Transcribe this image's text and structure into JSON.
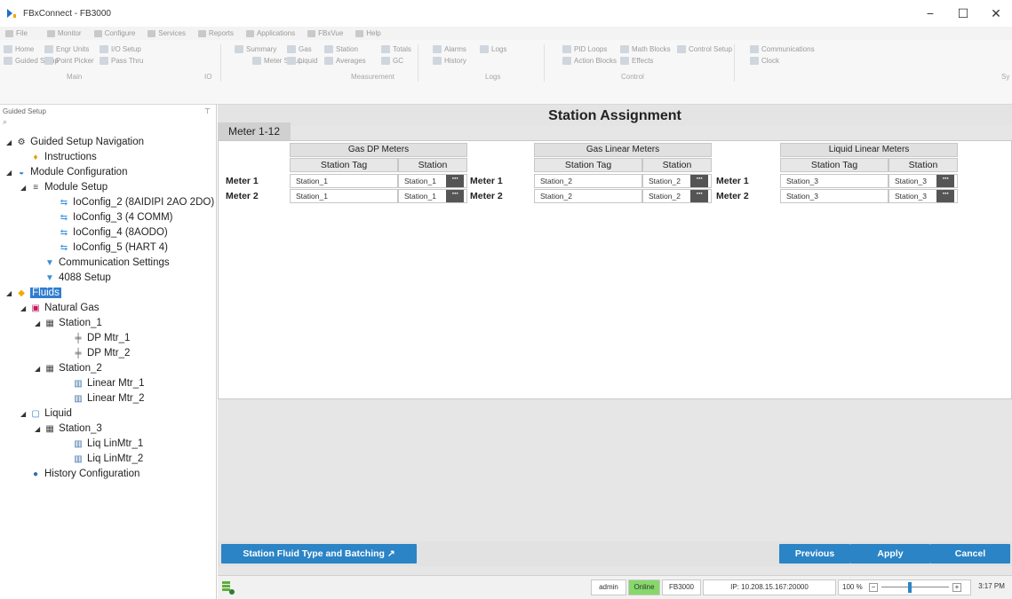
{
  "window": {
    "title": "FBxConnect - FB3000",
    "minimize": "−",
    "maximize": "☐",
    "close": "✕"
  },
  "menu": [
    "File",
    "Monitor",
    "Configure",
    "Services",
    "Reports",
    "Applications",
    "FBxVue",
    "Help"
  ],
  "ribbon": {
    "main": {
      "items": [
        "Home",
        "Engr Units",
        "I/O Setup",
        "Guided Setup",
        "Point Picker",
        "Pass Thru"
      ],
      "group": "Main",
      "group2": "IO"
    },
    "measurement": {
      "items": [
        "Summary",
        "Gas",
        "Station",
        "Totals",
        "Meter Setup",
        "Liquid",
        "Averages",
        "GC"
      ],
      "group": "Measurement"
    },
    "logs": {
      "items": [
        "Alarms",
        "Logs",
        "History"
      ],
      "group": "Logs"
    },
    "control": {
      "items": [
        "PID Loops",
        "Math Blocks",
        "Control Setup",
        "Action Blocks",
        "Effects"
      ],
      "group": "Control"
    },
    "comm": {
      "items": [
        "Communications",
        "Clock"
      ],
      "group": "Sy"
    }
  },
  "leftpanel": {
    "title": "Guided Setup",
    "pin": "⊤",
    "search_icon": "⌕"
  },
  "tree": [
    {
      "label": "Guided Setup Navigation",
      "level": 0,
      "expand": "◢",
      "icon": "gear-icon"
    },
    {
      "label": "Instructions",
      "level": 1,
      "icon": "pin-icon"
    },
    {
      "label": "Module Configuration",
      "level": 0,
      "expand": "◢",
      "icon": "module-icon"
    },
    {
      "label": "Module Setup",
      "level": 1,
      "expand": "◢",
      "icon": "list-icon"
    },
    {
      "label": "IoConfig_2 (8AIDIPI 2AO 2DO)",
      "level": 3,
      "icon": "io-icon"
    },
    {
      "label": "IoConfig_3 (4 COMM)",
      "level": 3,
      "icon": "io-icon"
    },
    {
      "label": "IoConfig_4 (8AODO)",
      "level": 3,
      "icon": "io-icon"
    },
    {
      "label": "IoConfig_5 (HART 4)",
      "level": 3,
      "icon": "io-icon"
    },
    {
      "label": "Communication Settings",
      "level": 2,
      "icon": "comm-icon"
    },
    {
      "label": "4088 Setup",
      "level": 2,
      "icon": "transmitter-icon"
    },
    {
      "label": "Fluids",
      "level": 0,
      "expand": "◢",
      "icon": "fluids-icon",
      "selected": true
    },
    {
      "label": "Natural Gas",
      "level": 1,
      "expand": "◢",
      "icon": "gas-icon"
    },
    {
      "label": "Station_1",
      "level": 2,
      "expand": "◢",
      "icon": "station-icon"
    },
    {
      "label": "DP Mtr_1",
      "level": 4,
      "icon": "dp-meter-icon"
    },
    {
      "label": "DP Mtr_2",
      "level": 4,
      "icon": "dp-meter-icon"
    },
    {
      "label": "Station_2",
      "level": 2,
      "expand": "◢",
      "icon": "station-icon"
    },
    {
      "label": "Linear Mtr_1",
      "level": 4,
      "icon": "linear-meter-icon"
    },
    {
      "label": "Linear Mtr_2",
      "level": 4,
      "icon": "linear-meter-icon"
    },
    {
      "label": "Liquid",
      "level": 1,
      "expand": "◢",
      "icon": "liquid-icon"
    },
    {
      "label": "Station_3",
      "level": 2,
      "expand": "◢",
      "icon": "station-icon"
    },
    {
      "label": "Liq LinMtr_1",
      "level": 4,
      "icon": "linear-meter-icon"
    },
    {
      "label": "Liq LinMtr_2",
      "level": 4,
      "icon": "linear-meter-icon"
    },
    {
      "label": "History Configuration",
      "level": 1,
      "icon": "history-icon"
    }
  ],
  "main": {
    "title": "Station Assignment",
    "tab": "Meter 1-12",
    "groups": [
      {
        "name": "Gas DP Meters",
        "col_tag": "Station Tag",
        "col_station": "Station",
        "rows": [
          {
            "meter": "Meter 1",
            "tag": "Station_1",
            "station": "Station_1"
          },
          {
            "meter": "Meter 2",
            "tag": "Station_1",
            "station": "Station_1"
          }
        ]
      },
      {
        "name": "Gas Linear Meters",
        "col_tag": "Station Tag",
        "col_station": "Station",
        "rows": [
          {
            "meter": "Meter 1",
            "tag": "Station_2",
            "station": "Station_2"
          },
          {
            "meter": "Meter 2",
            "tag": "Station_2",
            "station": "Station_2"
          }
        ]
      },
      {
        "name": "Liquid Linear Meters",
        "col_tag": "Station Tag",
        "col_station": "Station",
        "rows": [
          {
            "meter": "Meter 1",
            "tag": "Station_3",
            "station": "Station_3"
          },
          {
            "meter": "Meter 2",
            "tag": "Station_3",
            "station": "Station_3"
          }
        ]
      }
    ],
    "dots": "···"
  },
  "buttons": {
    "fluid_type": "Station Fluid Type and Batching  ↗",
    "previous": "Previous",
    "apply": "Apply",
    "cancel": "Cancel"
  },
  "status": {
    "user": "admin",
    "connection": "Online",
    "device": "FB3000",
    "ip": "IP: 10.208.15.167:20000",
    "zoom": "100 %",
    "zoom_minus": "−",
    "zoom_plus": "+",
    "time": "3:17 PM"
  },
  "colors": {
    "accent": "#2b84c6",
    "online": "#86d86a",
    "selected": "#2f7dd0"
  }
}
